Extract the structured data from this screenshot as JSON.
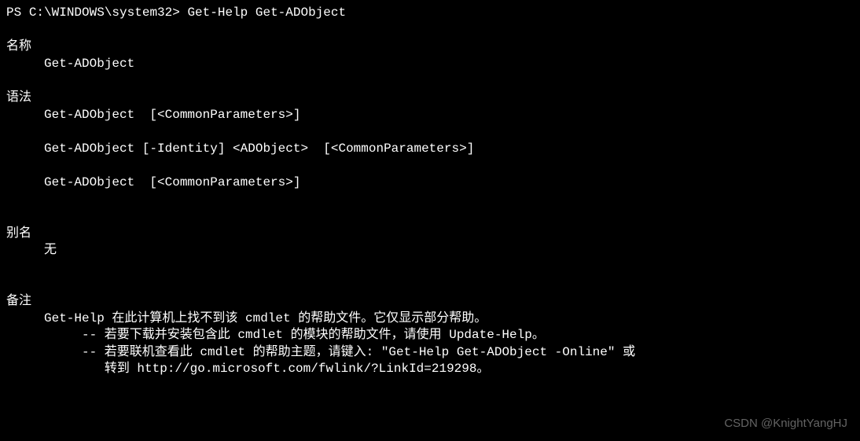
{
  "prompt": {
    "prefix": "PS ",
    "path": "C:\\WINDOWS\\system32",
    "separator": "> ",
    "command": "Get-Help Get-ADObject"
  },
  "sections": {
    "name": {
      "header": "名称",
      "value": "Get-ADObject"
    },
    "syntax": {
      "header": "语法",
      "lines": [
        "Get-ADObject  [<CommonParameters>]",
        "Get-ADObject [-Identity] <ADObject>  [<CommonParameters>]",
        "Get-ADObject  [<CommonParameters>]"
      ]
    },
    "aliases": {
      "header": "别名",
      "value": "无"
    },
    "remarks": {
      "header": "备注",
      "line1": "Get-Help 在此计算机上找不到该 cmdlet 的帮助文件。它仅显示部分帮助。",
      "line2": "-- 若要下载并安装包含此 cmdlet 的模块的帮助文件，请使用 Update-Help。",
      "line3": "-- 若要联机查看此 cmdlet 的帮助主题，请键入: \"Get-Help Get-ADObject -Online\" 或",
      "line4": "   转到 http://go.microsoft.com/fwlink/?LinkId=219298。"
    }
  },
  "watermark": "CSDN @KnightYangHJ"
}
